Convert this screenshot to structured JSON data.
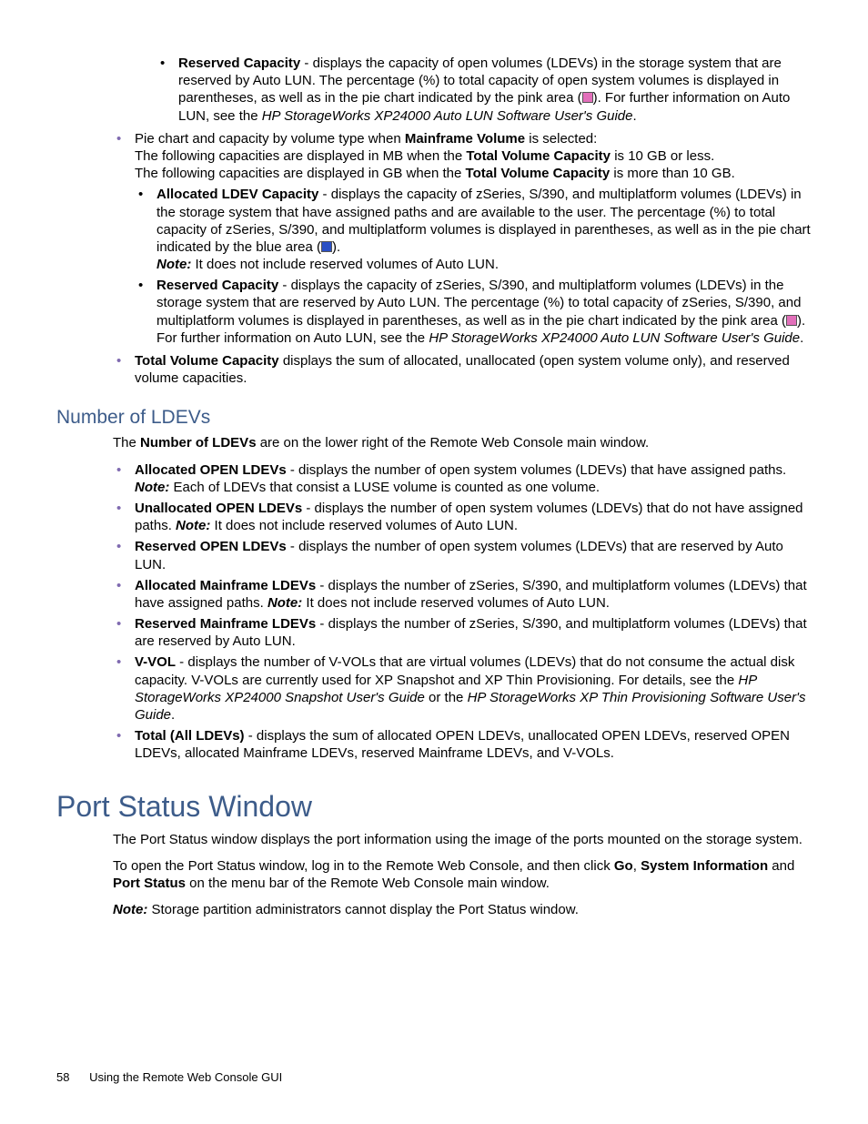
{
  "sec1": {
    "reservedCapacity": {
      "label": "Reserved Capacity",
      "text1": " - displays the capacity of open volumes (LDEVs) in the storage system that are reserved by Auto LUN. The percentage (%) to total capacity of open system volumes is displayed in parentheses, as well as in the pie chart indicated by the pink area (",
      "text2": "). For further information on Auto LUN, see the ",
      "ref": "HP StorageWorks XP24000 Auto LUN Software User's Guide",
      "text3": "."
    },
    "pieMainframe": {
      "intro1a": "Pie chart and capacity by volume type when ",
      "intro1b": "Mainframe Volume",
      "intro1c": " is selected:",
      "line2a": "The following capacities are displayed in MB when the ",
      "line2b": "Total Volume Capacity",
      "line2c": " is 10 GB or less.",
      "line3a": "The following capacities are displayed in GB when the ",
      "line3b": "Total Volume Capacity",
      "line3c": " is more than 10 GB.",
      "alloc": {
        "label": "Allocated LDEV Capacity",
        "text1": " - displays the capacity of zSeries, S/390, and multiplatform volumes (LDEVs) in the storage system that have assigned paths and are available to the user. The percentage (%) to total capacity of zSeries, S/390, and multiplatform volumes is displayed in parentheses, as well as in the pie chart indicated by the blue area (",
        "text2": ").",
        "noteLabel": "Note:",
        "noteText": " It does not include reserved volumes of Auto LUN."
      },
      "reserved": {
        "label": "Reserved Capacity",
        "text1": " - displays the capacity of zSeries, S/390, and multiplatform volumes (LDEVs) in the storage system that are reserved by Auto LUN. The percentage (%) to total capacity of zSeries, S/390, and multiplatform volumes is displayed in parentheses, as well as in the pie chart indicated by the pink area (",
        "text2": "). For further information on Auto LUN, see the ",
        "ref": "HP StorageWorks XP24000 Auto LUN Software User's Guide",
        "text3": "."
      }
    },
    "totalVolume": {
      "label": "Total Volume Capacity",
      "text": " displays the sum of allocated, unallocated (open system volume only), and reserved volume capacities."
    }
  },
  "ldev": {
    "heading": "Number of LDEVs",
    "intro1": "The ",
    "intro2": "Number of LDEVs",
    "intro3": " are on the lower right of the Remote Web Console main window.",
    "items": {
      "allocOpen": {
        "label": "Allocated OPEN LDEVs",
        "text": " - displays the number of open system volumes (LDEVs) that have assigned paths. ",
        "noteLabel": "Note:",
        "noteText": " Each of LDEVs that consist a LUSE volume is counted as one volume."
      },
      "unallocOpen": {
        "label": "Unallocated OPEN LDEVs",
        "text": " - displays the number of open system volumes (LDEVs) that do not have assigned paths. ",
        "noteLabel": "Note:",
        "noteText": " It does not include reserved volumes of Auto LUN."
      },
      "reservedOpen": {
        "label": "Reserved OPEN LDEVs",
        "text": " - displays the number of open system volumes (LDEVs) that are reserved by Auto LUN."
      },
      "allocMain": {
        "label": "Allocated Mainframe LDEVs",
        "text": " - displays the number of zSeries, S/390, and multiplatform volumes (LDEVs) that have assigned paths. ",
        "noteLabel": "Note:",
        "noteText": " It does not include reserved volumes of Auto LUN."
      },
      "reservedMain": {
        "label": "Reserved Mainframe LDEVs",
        "text": " - displays the number of zSeries, S/390, and multiplatform volumes (LDEVs) that are reserved by Auto LUN."
      },
      "vvol": {
        "label": "V-VOL",
        "text1": " - displays the number of V-VOLs that are virtual volumes (LDEVs) that do not consume the actual disk capacity. V-VOLs are currently used for XP Snapshot and XP Thin Provisioning. For details, see the ",
        "ref1": "HP StorageWorks XP24000 Snapshot User's Guide",
        "mid": " or the ",
        "ref2": "HP StorageWorks XP Thin Provisioning Software User's Guide",
        "text2": "."
      },
      "total": {
        "label": "Total (All LDEVs)",
        "text": " - displays the sum of allocated OPEN LDEVs, unallocated OPEN LDEVs, reserved OPEN LDEVs, allocated Mainframe LDEVs, reserved Mainframe LDEVs, and V-VOLs."
      }
    }
  },
  "port": {
    "heading": "Port Status Window",
    "p1": "The Port Status window displays the port information using the image of the ports mounted on the storage system.",
    "p2a": "To open the Port Status window, log in to the Remote Web Console, and then click ",
    "p2b": "Go",
    "p2c": ", ",
    "p2d": "System Information",
    "p2e": " and ",
    "p2f": "Port Status",
    "p2g": " on the menu bar of the Remote Web Console main window.",
    "noteLabel": "Note:",
    "noteText": " Storage partition administrators cannot display the Port Status window."
  },
  "footer": {
    "page": "58",
    "title": "Using the Remote Web Console GUI"
  }
}
